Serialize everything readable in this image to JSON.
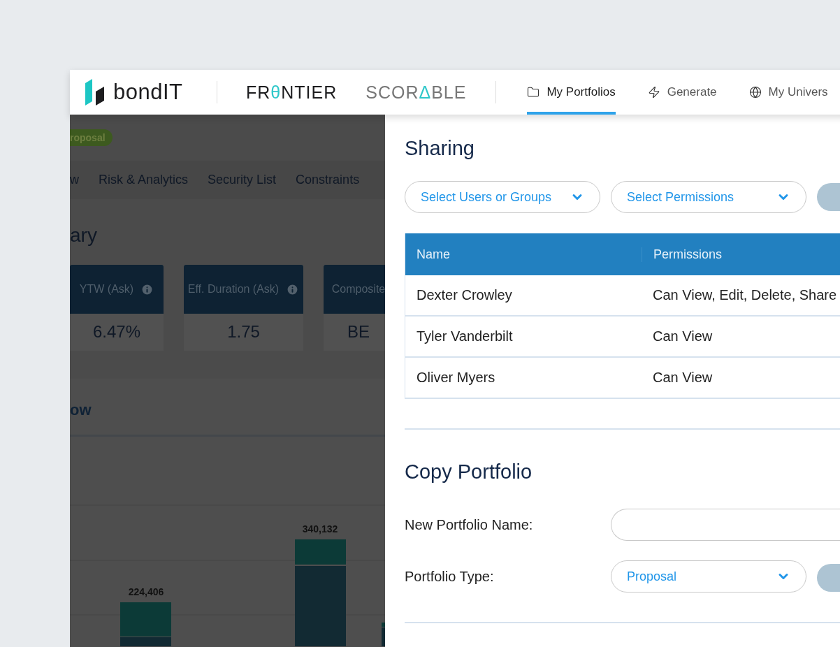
{
  "header": {
    "logo": "bondIT",
    "products": [
      {
        "parts": [
          "FR",
          "θ",
          "NTIER"
        ],
        "selected": true
      },
      {
        "parts": [
          "SCOR",
          "Δ",
          "BLE"
        ],
        "selected": false
      }
    ],
    "nav": [
      {
        "label": "My Portfolios",
        "selected": true
      },
      {
        "label": "Generate",
        "selected": false
      },
      {
        "label": "My Univers",
        "selected": false
      }
    ]
  },
  "background_page": {
    "badge": "roposal",
    "tabs": [
      "w",
      "Risk & Analytics",
      "Security List",
      "Constraints"
    ],
    "summary_title": "ary",
    "cards": [
      {
        "label": "YTW (Ask)",
        "info": true,
        "value": "6.47%"
      },
      {
        "label": "Eff. Duration (Ask)",
        "info": true,
        "value": "1.75"
      },
      {
        "label": "Composite",
        "info": false,
        "value": "BE"
      }
    ],
    "section_title": "ow",
    "bar_labels": [
      "224,406",
      "340,132"
    ]
  },
  "sharing": {
    "title": "Sharing",
    "selects": [
      "Select Users or Groups",
      "Select Permissions"
    ],
    "table": {
      "columns": [
        "Name",
        "Permissions"
      ],
      "rows": [
        [
          "Dexter Crowley",
          "Can View, Edit, Delete, Share"
        ],
        [
          "Tyler Vanderbilt",
          "Can View"
        ],
        [
          "Oliver Myers",
          "Can View"
        ]
      ]
    }
  },
  "copy": {
    "title": "Copy Portfolio",
    "fields": [
      {
        "kind": "input",
        "label": "New Portfolio Name:"
      },
      {
        "kind": "select",
        "label": "Portfolio Type:",
        "value": "Proposal"
      }
    ]
  }
}
